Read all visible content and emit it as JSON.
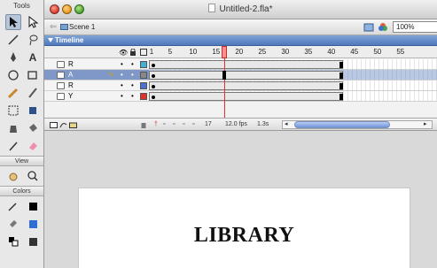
{
  "tools_panel": {
    "title": "Tools",
    "view_section": "View",
    "colors_section": "Colors"
  },
  "window": {
    "title": "Untitled-2.fla*"
  },
  "scenebar": {
    "scene_label": "Scene 1",
    "zoom": "100%"
  },
  "timeline": {
    "header_label": "Timeline",
    "frame_numbers": [
      "1",
      "5",
      "10",
      "15",
      "20",
      "25",
      "30",
      "35",
      "40",
      "45",
      "50",
      "55"
    ],
    "current_frame": "17",
    "fps": "12.0 fps",
    "time": "1.3s",
    "layers": [
      {
        "name": "R",
        "color": "#3fb1d4"
      },
      {
        "name": "A",
        "color": "#888888"
      },
      {
        "name": "R",
        "color": "#4c6fd6"
      },
      {
        "name": "Y",
        "color": "#e0312a"
      }
    ]
  },
  "stage": {
    "text": "LIBRARY"
  }
}
